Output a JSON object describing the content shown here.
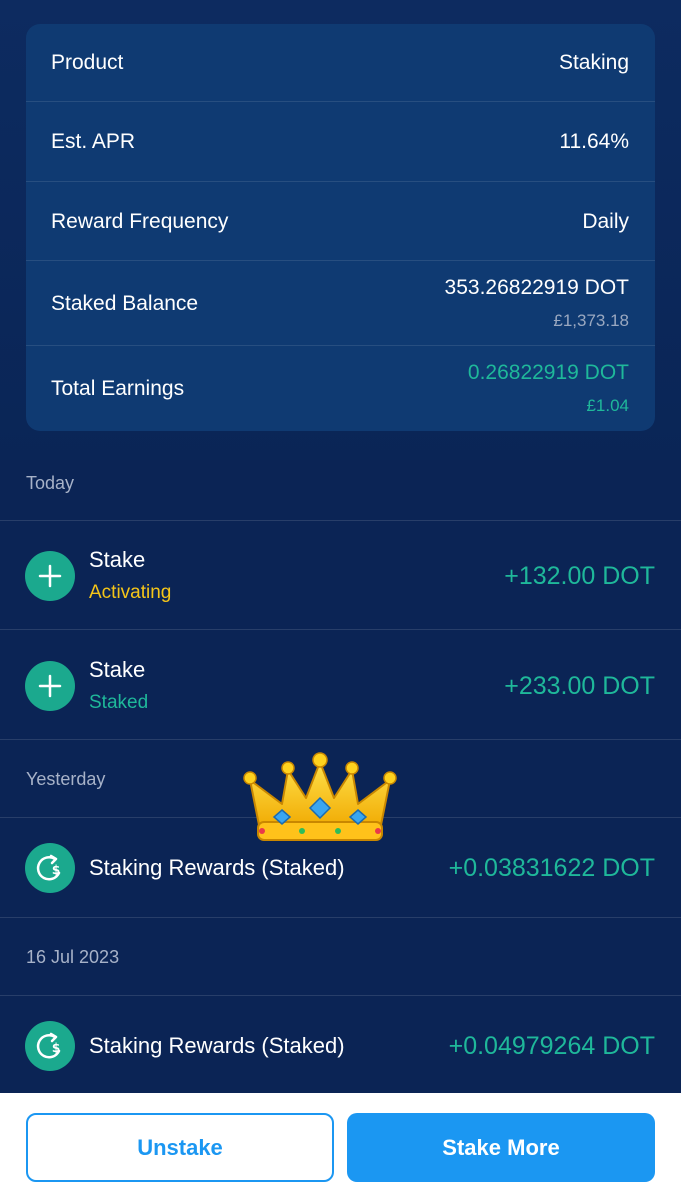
{
  "summary": {
    "product_label": "Product",
    "product_value": "Staking",
    "apr_label": "Est. APR",
    "apr_value": "11.64%",
    "frequency_label": "Reward Frequency",
    "frequency_value": "Daily",
    "staked_label": "Staked Balance",
    "staked_value": "353.26822919 DOT",
    "staked_fiat": "£1,373.18",
    "earnings_label": "Total Earnings",
    "earnings_value": "0.26822919 DOT",
    "earnings_fiat": "£1.04"
  },
  "sections": {
    "today": "Today",
    "yesterday": "Yesterday",
    "jul16": "16 Jul 2023"
  },
  "transactions": [
    {
      "title": "Stake",
      "status": "Activating",
      "amount": "+132.00 DOT",
      "icon": "plus-icon"
    },
    {
      "title": "Stake",
      "status": "Staked",
      "amount": "+233.00 DOT",
      "icon": "plus-icon"
    },
    {
      "title": "Staking Rewards (Staked)",
      "amount": "+0.03831622 DOT",
      "icon": "reward-icon"
    },
    {
      "title": "Staking Rewards (Staked)",
      "amount": "+0.04979264 DOT",
      "icon": "reward-icon"
    }
  ],
  "buttons": {
    "unstake": "Unstake",
    "stake_more": "Stake More"
  },
  "colors": {
    "background": "#0b2455",
    "card": "#0f3a72",
    "accent_green": "#1fb89a",
    "status_yellow": "#f5c518",
    "button_blue": "#1b97f2"
  }
}
